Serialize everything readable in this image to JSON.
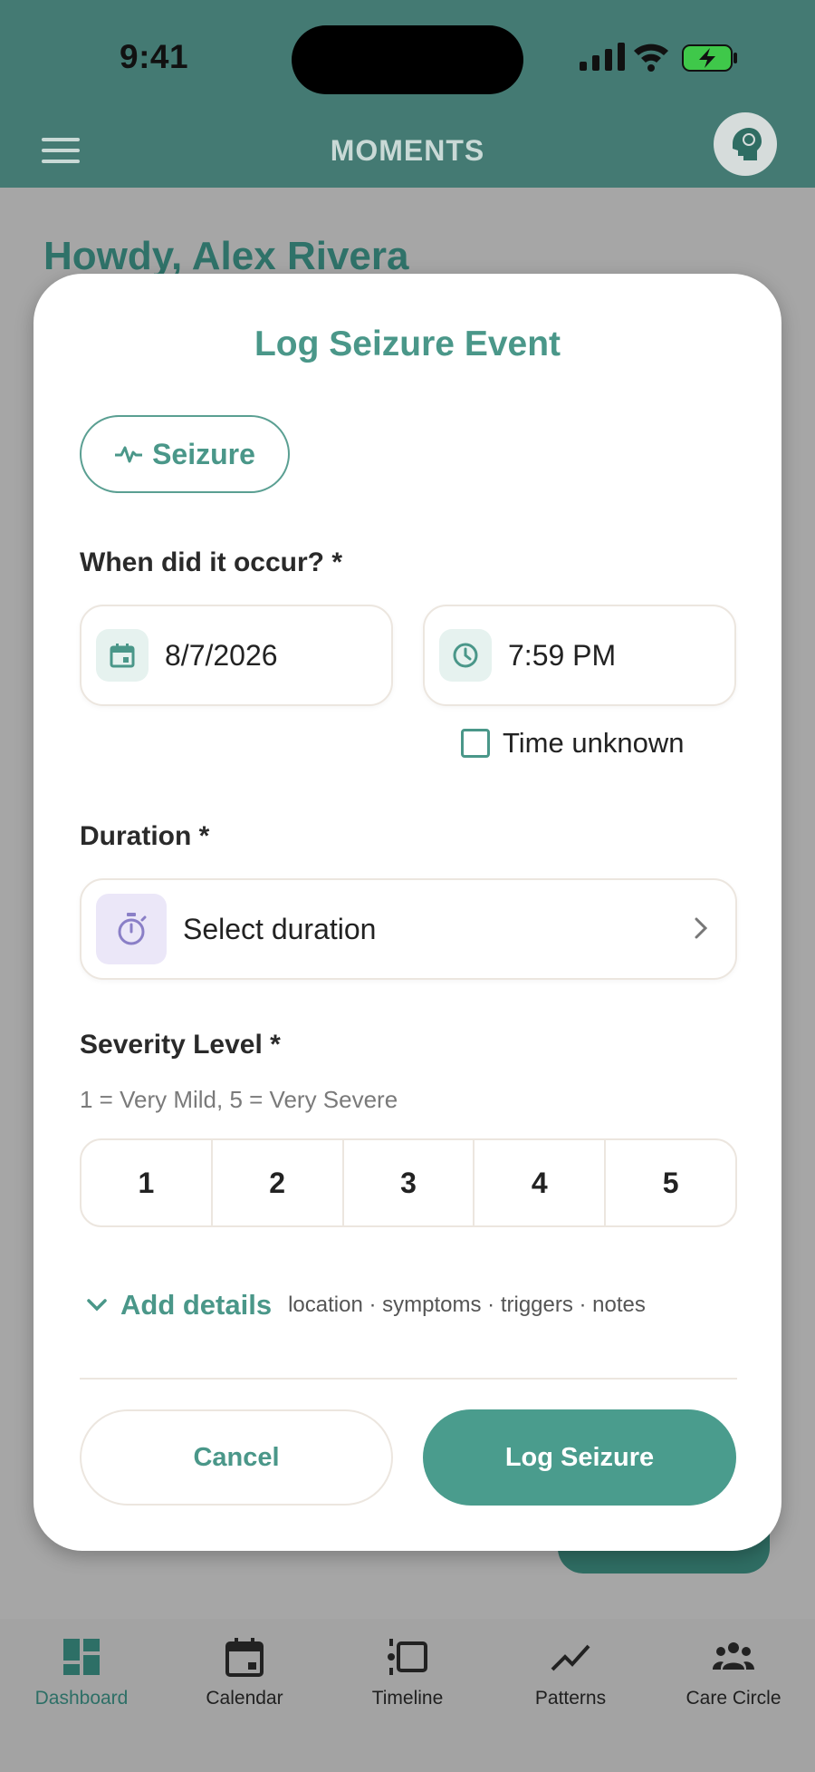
{
  "status_bar": {
    "time": "9:41"
  },
  "header": {
    "title": "MOMENTS"
  },
  "background": {
    "greeting": "Howdy, Alex Rivera"
  },
  "modal": {
    "title": "Log Seizure Event",
    "event_type": "Seizure",
    "when_label": "When did it occur? *",
    "date_value": "8/7/2026",
    "time_value": "7:59 PM",
    "time_unknown_label": "Time unknown",
    "time_unknown_checked": false,
    "duration_label": "Duration *",
    "duration_placeholder": "Select duration",
    "severity_label": "Severity Level *",
    "severity_hint": "1 = Very Mild, 5 = Very Severe",
    "severity_options": [
      "1",
      "2",
      "3",
      "4",
      "5"
    ],
    "add_details_label": "Add details",
    "add_details_hint": "location · symptoms · triggers · notes",
    "cancel_label": "Cancel",
    "submit_label": "Log Seizure"
  },
  "bottom_nav": [
    {
      "label": "Dashboard",
      "icon": "dashboard-icon",
      "active": true
    },
    {
      "label": "Calendar",
      "icon": "calendar-icon",
      "active": false
    },
    {
      "label": "Timeline",
      "icon": "timeline-icon",
      "active": false
    },
    {
      "label": "Patterns",
      "icon": "trend-icon",
      "active": false
    },
    {
      "label": "Care Circle",
      "icon": "people-icon",
      "active": false
    }
  ],
  "colors": {
    "header_bg": "#447a73",
    "accent": "#4a9789",
    "primary_button": "#4a9c8d",
    "scrim": "#a6a6a6"
  }
}
